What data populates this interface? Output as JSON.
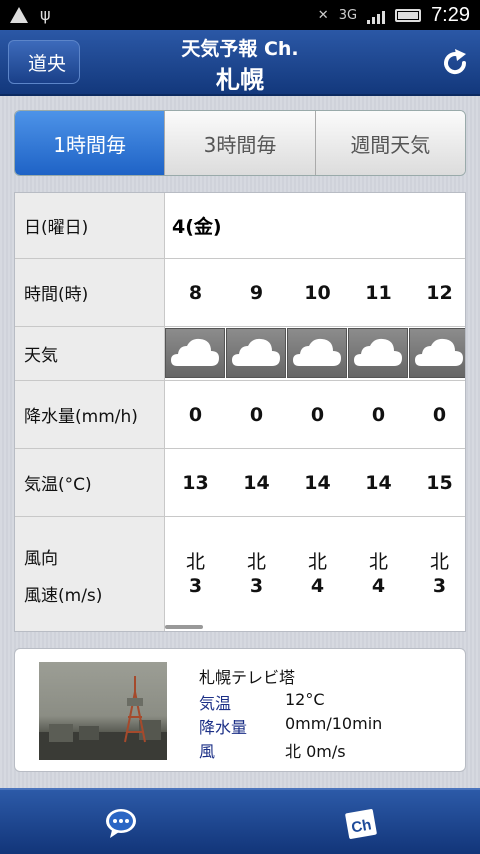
{
  "status_bar": {
    "time": "7:29",
    "network": "3G"
  },
  "header": {
    "back_label": "道央",
    "subtitle": "天気予報 Ch.",
    "title": "札幌"
  },
  "tabs": [
    {
      "label": "1時間毎",
      "active": true
    },
    {
      "label": "3時間毎",
      "active": false
    },
    {
      "label": "週間天気",
      "active": false
    }
  ],
  "forecast": {
    "labels": {
      "date": "日(曜日)",
      "time": "時間(時)",
      "weather": "天気",
      "precip": "降水量(mm/h)",
      "temp": "気温(°C)",
      "wind_dir": "風向",
      "wind_speed": "風速(m/s)"
    },
    "date": "4(金)",
    "hours": [
      "8",
      "9",
      "10",
      "11",
      "12"
    ],
    "weather": [
      "cloud-icon",
      "cloud-icon",
      "cloud-icon",
      "cloud-icon",
      "cloud-icon"
    ],
    "precip": [
      "0",
      "0",
      "0",
      "0",
      "0"
    ],
    "temp": [
      "13",
      "14",
      "14",
      "14",
      "15"
    ],
    "wind_dir": [
      "北",
      "北",
      "北",
      "北",
      "北"
    ],
    "wind_speed": [
      "3",
      "3",
      "4",
      "4",
      "3"
    ]
  },
  "camera": {
    "location": "札幌テレビ塔",
    "rows": [
      {
        "key": "気温",
        "value": "12°C"
      },
      {
        "key": "降水量",
        "value": "0mm/10min"
      },
      {
        "key": "風",
        "value": "北 0m/s"
      }
    ]
  },
  "bottom": {
    "ch_label": "Ch"
  },
  "colors": {
    "header_blue": "#1f4a96",
    "tab_active": "#2f75d6",
    "label_blue": "#1b2f86"
  }
}
